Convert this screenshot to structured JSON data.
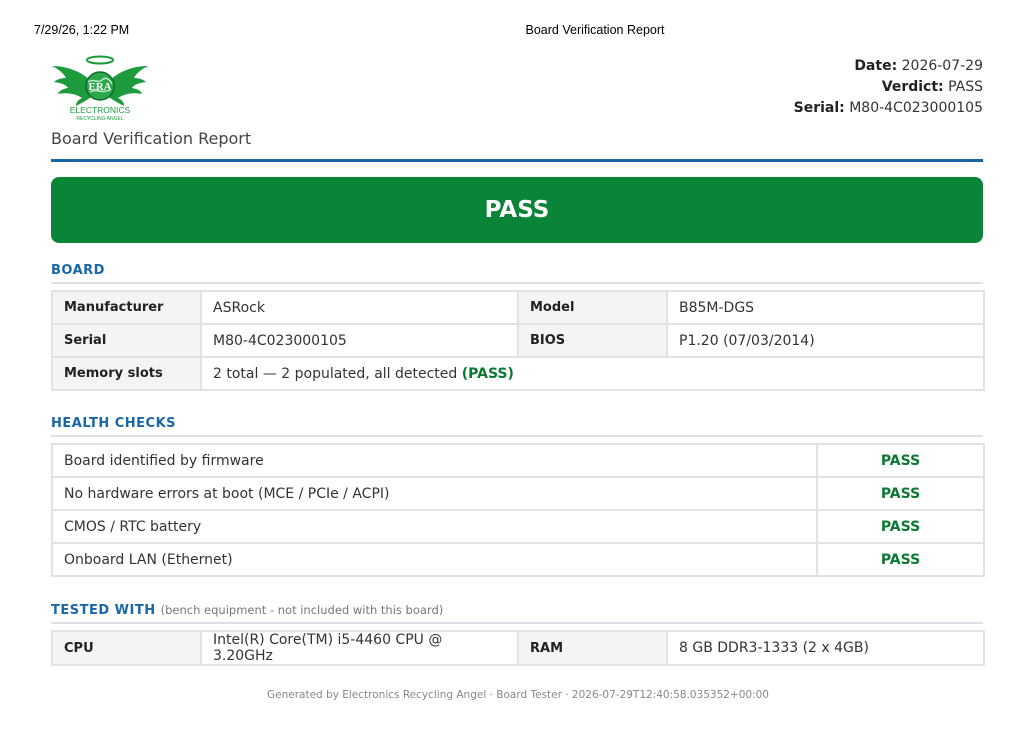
{
  "print_header": {
    "datetime": "7/29/26, 1:22 PM",
    "title": "Board Verification Report"
  },
  "logo": {
    "text_top": "ERA",
    "text_main": "ELECTRONICS",
    "text_sub": "RECYCLING ANGEL",
    "color": "#1e9b3c"
  },
  "subtitle": "Board Verification Report",
  "meta": {
    "date_label": "Date:",
    "date_value": "2026-07-29",
    "verdict_label": "Verdict:",
    "verdict_value": "PASS",
    "serial_label": "Serial:",
    "serial_value": "M80-4C023000105"
  },
  "banner": {
    "text": "PASS",
    "color": "#0a8436"
  },
  "board": {
    "heading": "BOARD",
    "manufacturer_label": "Manufacturer",
    "manufacturer_value": "ASRock",
    "model_label": "Model",
    "model_value": "B85M-DGS",
    "serial_label": "Serial",
    "serial_value": "M80-4C023000105",
    "bios_label": "BIOS",
    "bios_value": "P1.20 (07/03/2014)",
    "memory_label": "Memory slots",
    "memory_value": "2 total — 2 populated, all detected",
    "memory_status": "(PASS)"
  },
  "health": {
    "heading": "HEALTH CHECKS",
    "checks": [
      {
        "name": "Board identified by firmware",
        "status": "PASS"
      },
      {
        "name": "No hardware errors at boot (MCE / PCIe / ACPI)",
        "status": "PASS"
      },
      {
        "name": "CMOS / RTC battery",
        "status": "PASS"
      },
      {
        "name": "Onboard LAN (Ethernet)",
        "status": "PASS"
      }
    ]
  },
  "tested": {
    "heading": "TESTED WITH",
    "note": "(bench equipment - not included with this board)",
    "cpu_label": "CPU",
    "cpu_value": "Intel(R) Core(TM) i5-4460 CPU @ 3.20GHz",
    "ram_label": "RAM",
    "ram_value": "8 GB DDR3-1333 (2 x 4GB)"
  },
  "footer": "Generated by Electronics Recycling Angel · Board Tester · 2026-07-29T12:40:58.035352+00:00",
  "colors": {
    "accent": "#1a67a8",
    "pass": "#0a7a33"
  }
}
